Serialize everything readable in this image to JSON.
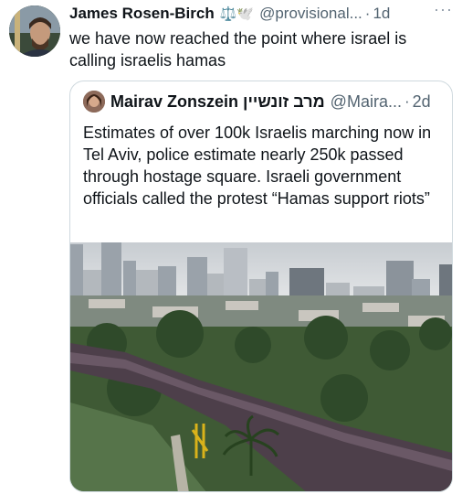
{
  "tweet": {
    "author_name": "James Rosen-Birch",
    "badges": "⚖️🕊️",
    "handle": "@provisional...",
    "separator": "·",
    "time": "1d",
    "more": "···",
    "text": "we have now reached the point where israel is calling israelis hamas"
  },
  "quote": {
    "author_name": "Mairav Zonszein מרב זונשיין",
    "handle": "@Maira...",
    "separator": "·",
    "time": "2d",
    "text": "Estimates of over 100k Israelis marching now in Tel Aviv, police estimate nearly 250k passed through hostage square. Israeli government officials called the protest “Hamas support riots”"
  },
  "photo": {
    "icon": "aerial-crowd-photo"
  }
}
